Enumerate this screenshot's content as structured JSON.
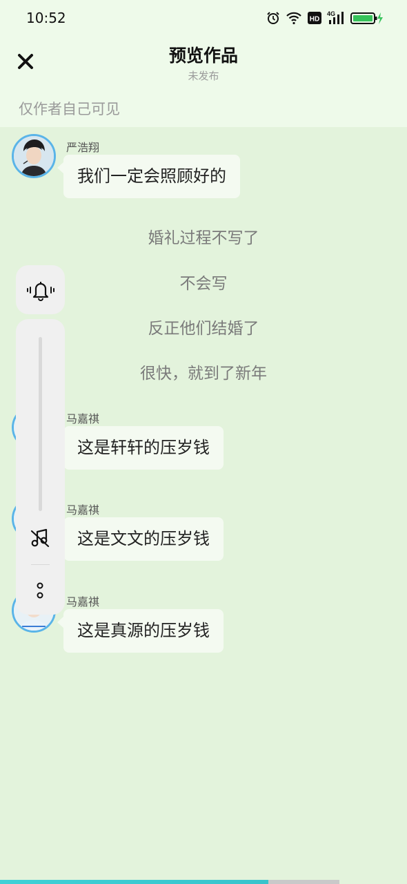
{
  "status_bar": {
    "time": "10:52",
    "icons": [
      "alarm-icon",
      "wifi-icon",
      "hd-icon",
      "signal-4g-icon",
      "battery-charging-icon"
    ],
    "hd_label": "HD",
    "network_label": "4G"
  },
  "header": {
    "close_icon": "close-icon",
    "title": "预览作品",
    "subtitle": "未发布",
    "visibility_note": "仅作者自己可见"
  },
  "messages": [
    {
      "type": "chat",
      "sender": "严浩翔",
      "text": "我们一定会照顾好的"
    },
    {
      "type": "narration",
      "text": "婚礼过程不写了"
    },
    {
      "type": "narration",
      "text": "不会写"
    },
    {
      "type": "narration",
      "text": "反正他们结婚了"
    },
    {
      "type": "narration",
      "text": "很快，就到了新年"
    },
    {
      "type": "chat",
      "sender": "马嘉祺",
      "text": "这是轩轩的压岁钱"
    },
    {
      "type": "chat",
      "sender": "马嘉祺",
      "text": "这是文文的压岁钱"
    },
    {
      "type": "chat",
      "sender": "马嘉祺",
      "text": "这是真源的压岁钱"
    }
  ],
  "side_controls": {
    "icons": [
      "vibrate-bell-icon",
      "music-off-icon",
      "more-icon"
    ]
  },
  "progress": {
    "fraction": 0.79
  },
  "colors": {
    "page_background": "#e3f3dc",
    "header_background": "#eefaea",
    "bubble": "#f4faf1",
    "avatar_ring": "#5ab4e8",
    "progress_fill": "#3fd1d6",
    "charging": "#36c25a"
  }
}
